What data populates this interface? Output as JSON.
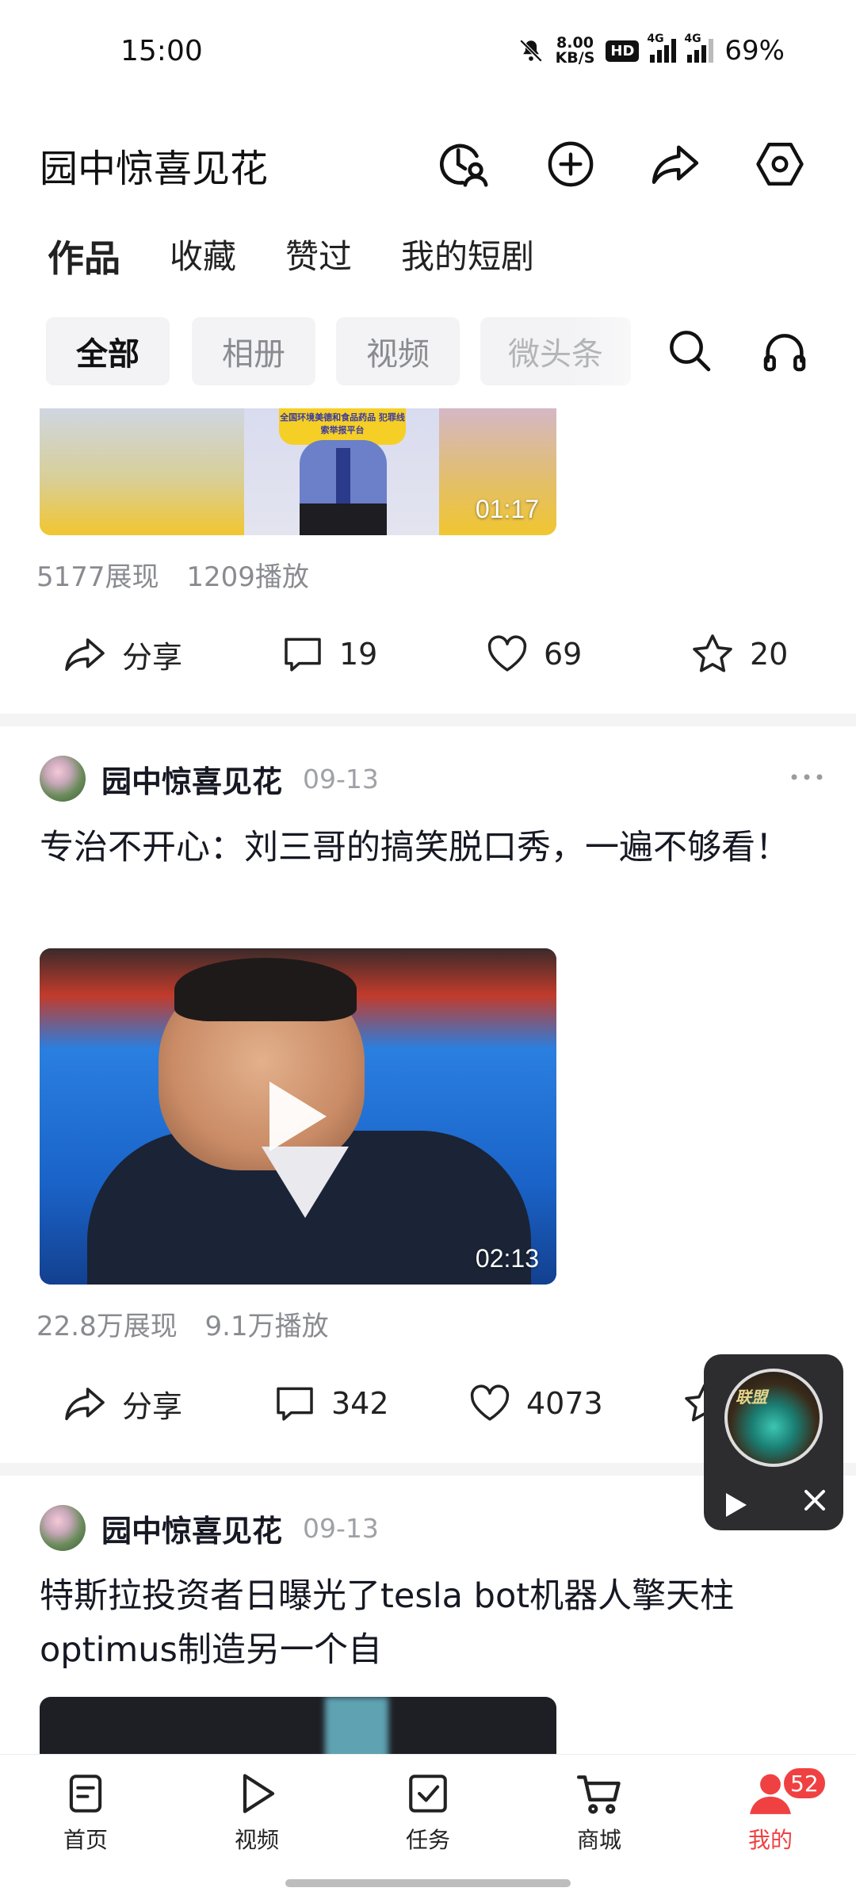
{
  "status_bar": {
    "time": "15:00",
    "net_speed": "8.00",
    "net_unit": "KB/S",
    "hd": "HD",
    "signal_1": "4G",
    "signal_2": "4G",
    "battery": "69%"
  },
  "header": {
    "title": "园中惊喜见花",
    "icons": [
      "history-user-icon",
      "add-circle-icon",
      "share-icon",
      "settings-hexagon-icon"
    ]
  },
  "tabs": [
    {
      "label": "作品",
      "active": true
    },
    {
      "label": "收藏",
      "active": false
    },
    {
      "label": "赞过",
      "active": false
    },
    {
      "label": "我的短剧",
      "active": false
    }
  ],
  "filters": [
    {
      "label": "全部",
      "active": true
    },
    {
      "label": "相册",
      "active": false
    },
    {
      "label": "视频",
      "active": false
    },
    {
      "label": "微头条",
      "active": false
    }
  ],
  "posts": [
    {
      "duration": "01:17",
      "thumb_sign_text": "全国环境美德和食品药品 犯罪线索举报平台",
      "impressions": "5177展现",
      "plays": "1209播放",
      "share": "分享",
      "comments": "19",
      "likes": "69",
      "favorites": "20"
    },
    {
      "author": "园中惊喜见花",
      "date": "09-13",
      "title": "专治不开心：刘三哥的搞笑脱口秀，一遍不够看！",
      "duration": "02:13",
      "impressions": "22.8万展现",
      "plays": "9.1万播放",
      "share": "分享",
      "comments": "342",
      "likes": "4073"
    },
    {
      "author": "园中惊喜见花",
      "date": "09-13",
      "title": "特斯拉投资者日曝光了tesla bot机器人擎天柱optimus制造另一个自"
    }
  ],
  "mini_player": {
    "cover_text": "联盟",
    "icons": [
      "play-icon",
      "close-icon"
    ]
  },
  "bottom_nav": [
    {
      "label": "首页",
      "icon": "home-doc-icon",
      "active": false
    },
    {
      "label": "视频",
      "icon": "play-icon",
      "active": false
    },
    {
      "label": "任务",
      "icon": "task-check-icon",
      "active": false
    },
    {
      "label": "商城",
      "icon": "cart-icon",
      "active": false
    },
    {
      "label": "我的",
      "icon": "profile-icon",
      "active": true,
      "badge": "52"
    }
  ],
  "colors": {
    "accent_red": "#f04142",
    "text_primary": "#161823",
    "text_secondary": "#8a8b91",
    "chip_bg": "#f3f3f5"
  }
}
